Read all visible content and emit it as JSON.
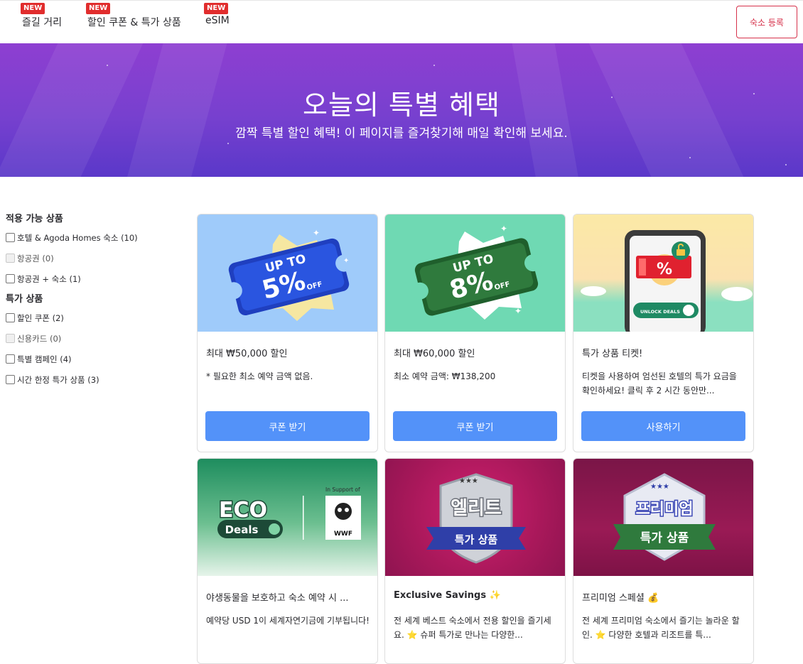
{
  "nav": {
    "items": [
      {
        "label": "즐길 거리",
        "badge": "NEW"
      },
      {
        "label": "할인 쿠폰 & 특가 상품",
        "badge": "NEW"
      },
      {
        "label": "eSIM",
        "badge": "NEW"
      }
    ],
    "register_label": "숙소 등록"
  },
  "hero": {
    "title": "오늘의 특별 혜택",
    "subtitle": "깜짝 특별 할인 혜택! 이 페이지를 즐겨찾기해 매일 확인해 보세요."
  },
  "filters": {
    "groups": [
      {
        "heading": "적용 가능 상품",
        "options": [
          {
            "label": "호텔 & Agoda Homes 숙소 (10)",
            "enabled": true
          },
          {
            "label": "항공권 (0)",
            "enabled": false
          },
          {
            "label": "항공권 + 숙소 (1)",
            "enabled": true
          }
        ]
      },
      {
        "heading": "특가 상품",
        "options": [
          {
            "label": "할인 쿠폰 (2)",
            "enabled": true
          },
          {
            "label": "신용카드 (0)",
            "enabled": false
          },
          {
            "label": "특별 캠페인 (4)",
            "enabled": true
          },
          {
            "label": "시간 한정 특가 상품 (3)",
            "enabled": true
          }
        ]
      }
    ]
  },
  "cards": [
    {
      "art_top": "UP TO",
      "art_main": "5%",
      "art_bottom": "OFF",
      "title": "최대 ₩50,000 할인",
      "desc": "* 필요한 최소 예약 금액 없음.",
      "button": "쿠폰 받기",
      "accent": "#2450d6"
    },
    {
      "art_top": "UP TO",
      "art_main": "8%",
      "art_bottom": "OFF",
      "title": "최대 ₩60,000 할인",
      "desc": "최소 예약 금액: ₩138,200",
      "button": "쿠폰 받기",
      "accent": "#2f7a3d"
    },
    {
      "art_main": "%",
      "art_bottom": "UNLOCK DEALS",
      "title": "특가 상품 티켓!",
      "desc": "티켓을 사용하여 엄선된 호텔의 특가 요금을 확인하세요! 클릭 후 2 시간 동안만...",
      "button": "사용하기",
      "accent": "#e0212f"
    },
    {
      "art_main": "ECO",
      "art_sub": "Deals",
      "art_support": "In Support of",
      "art_brand": "WWF",
      "title": "야생동물을 보호하고 숙소 예약 시 ...",
      "desc": "예약당 USD 1이 세계자연기금에 기부됩니다!",
      "accent": "#1f7a55"
    },
    {
      "art_main": "엘리트",
      "art_sub": "특가 상품",
      "title": "Exclusive Savings ✨",
      "desc": "전 세계 베스트 숙소에서 전용 할인을 즐기세요. ⭐ 슈퍼 특가로 만나는 다양한...",
      "accent": "#b8185f"
    },
    {
      "art_main": "프리미엄",
      "art_sub": "특가 상품",
      "title": "프리미엄 스페셜 💰",
      "desc": "전 세계 프리미엄 숙소에서 즐기는 놀라운 할인. ⭐ 다양한 호텔과 리조트를 특...",
      "accent": "#8a1548"
    }
  ]
}
